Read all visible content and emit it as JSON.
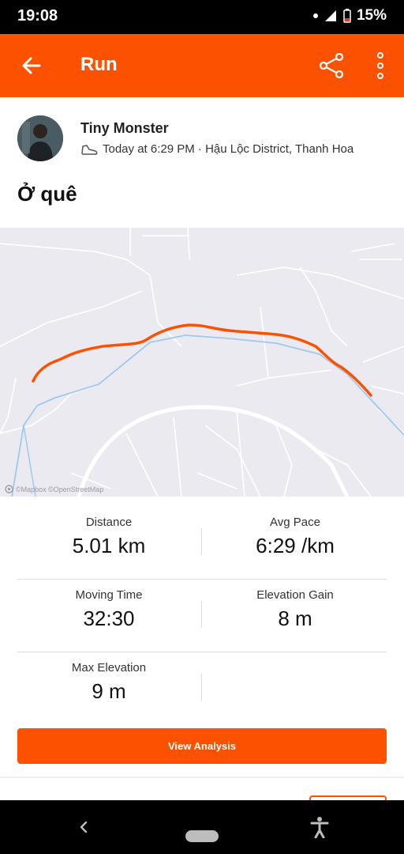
{
  "status_bar": {
    "time": "19:08",
    "battery": "15%"
  },
  "app_bar": {
    "title": "Run"
  },
  "activity": {
    "athlete_name": "Tiny Monster",
    "meta": "Today at 6:29 PM · Hậu Lộc District, Thanh Hoa",
    "title": "Ở quê"
  },
  "map": {
    "credit": "©Mapbox ©OpenStreetMap"
  },
  "stats": [
    {
      "label": "Distance",
      "value": "5.01 km"
    },
    {
      "label": "Avg Pace",
      "value": "6:29 /km"
    },
    {
      "label": "Moving Time",
      "value": "32:30"
    },
    {
      "label": "Elevation Gain",
      "value": "8 m"
    },
    {
      "label": "Max Elevation",
      "value": "9 m"
    }
  ],
  "view_analysis_label": "View Analysis",
  "colors": {
    "accent": "#fc5200",
    "route": "#fc5200",
    "river": "#9ec9ee",
    "map_bg": "#eceaf1"
  }
}
